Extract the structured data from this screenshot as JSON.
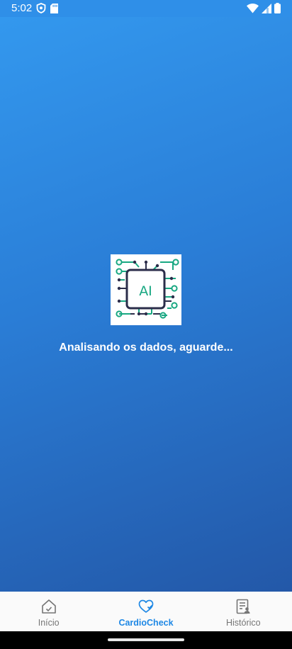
{
  "status_bar": {
    "time": "5:02"
  },
  "main": {
    "loading_text": "Analisando os dados, aguarde..."
  },
  "ai_logo": {
    "text": "AI"
  },
  "bottom_nav": {
    "items": [
      {
        "label": "Início",
        "icon": "home-icon"
      },
      {
        "label": "CardioCheck",
        "icon": "heart-check-icon",
        "active": true
      },
      {
        "label": "Histórico",
        "icon": "history-icon"
      }
    ]
  },
  "colors": {
    "accent": "#1e88e5",
    "inactive": "#757575",
    "circuit_green": "#19a882",
    "chip_outline": "#2b2d4a"
  }
}
